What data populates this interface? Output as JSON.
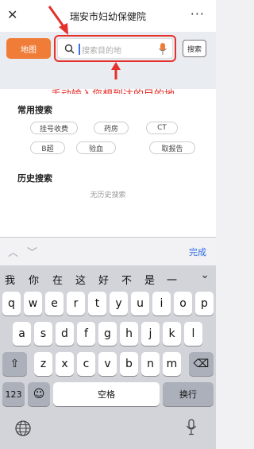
{
  "header": {
    "close_glyph": "✕",
    "title": "瑞安市妇幼保健院",
    "more_glyph": "···"
  },
  "search": {
    "map_label": "地图",
    "placeholder": "搜索目的地",
    "search_label": "搜索"
  },
  "annotation": {
    "text": "手动输入您想到达的目的地"
  },
  "common": {
    "title": "常用搜索",
    "tags": [
      "挂号收费",
      "药房",
      "CT",
      "B超",
      "验血",
      "取报告"
    ]
  },
  "history": {
    "title": "历史搜索",
    "empty": "无历史搜索"
  },
  "keyboard": {
    "done_label": "完成",
    "candidates": [
      "我",
      "你",
      "在",
      "这",
      "好",
      "不",
      "是",
      "一"
    ],
    "row1": [
      "q",
      "w",
      "e",
      "r",
      "t",
      "y",
      "u",
      "i",
      "o",
      "p"
    ],
    "row2": [
      "a",
      "s",
      "d",
      "f",
      "g",
      "h",
      "j",
      "k",
      "l"
    ],
    "row3": [
      "z",
      "x",
      "c",
      "v",
      "b",
      "n",
      "m"
    ],
    "num_label": "123",
    "emoji_glyph": "☺",
    "space_label": "空格",
    "return_label": "换行",
    "shift_glyph": "⇧",
    "delete_glyph": "⌫"
  },
  "colors": {
    "accent": "#ef7d38",
    "annotation_red": "#e5302b",
    "done_blue": "#2e6be6"
  }
}
